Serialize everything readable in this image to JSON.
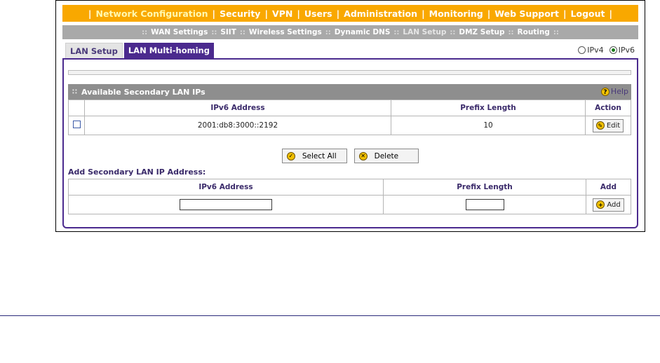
{
  "top_nav": {
    "items": [
      "Network Configuration",
      "Security",
      "VPN",
      "Users",
      "Administration",
      "Monitoring",
      "Web Support",
      "Logout"
    ],
    "active_index": 0
  },
  "sub_nav": {
    "items": [
      "WAN Settings",
      "SIIT",
      "Wireless Settings",
      "Dynamic DNS",
      "LAN Setup",
      "DMZ Setup",
      "Routing"
    ],
    "active_index": 4
  },
  "tabs": [
    {
      "label": "LAN Setup",
      "active": false
    },
    {
      "label": "LAN Multi-homing",
      "active": true
    }
  ],
  "ip_version": {
    "options": [
      "IPv4",
      "IPv6"
    ],
    "selected": "IPv6"
  },
  "available_section": {
    "title": "Available Secondary LAN IPs",
    "help_label": "Help",
    "columns": [
      "IPv6 Address",
      "Prefix Length",
      "Action"
    ],
    "rows": [
      {
        "address": "2001:db8:3000::2192",
        "prefix_length": "10",
        "action_label": "Edit",
        "checked": false
      }
    ],
    "select_all_label": "Select All",
    "delete_label": "Delete"
  },
  "add_section": {
    "title": "Add Secondary LAN IP Address:",
    "columns": [
      "IPv6 Address",
      "Prefix Length",
      "Add"
    ],
    "address_value": "",
    "prefix_value": "",
    "add_label": "Add"
  },
  "colors": {
    "top_nav_bg": "#f9a800",
    "sub_nav_bg": "#a9a9a9",
    "tab_active": "#4b2a8e",
    "section_header": "#8e8e8e"
  }
}
